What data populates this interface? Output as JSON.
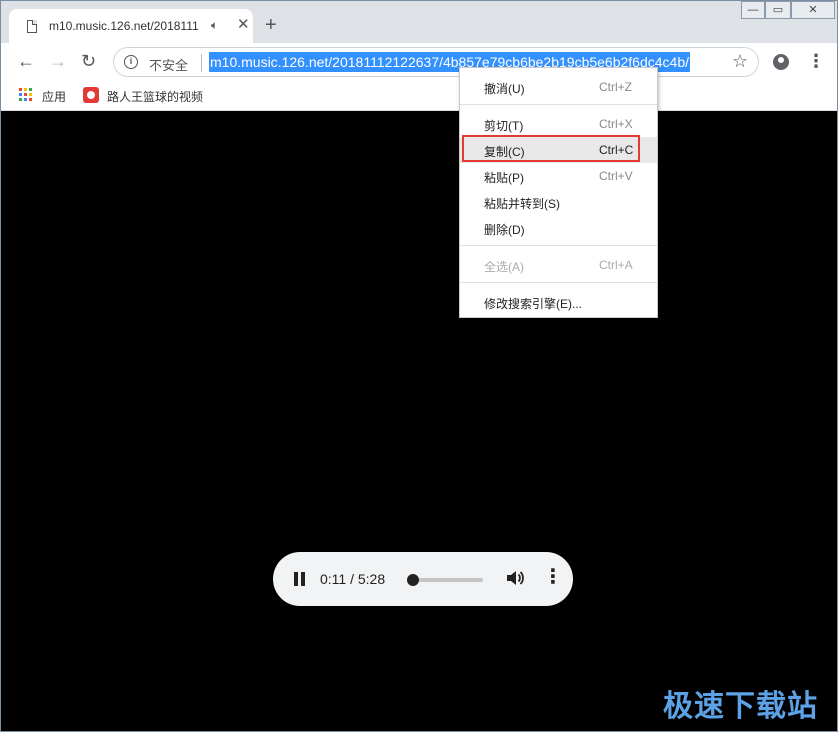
{
  "tab": {
    "title": "m10.music.126.net/2018111",
    "close_glyph": "✕"
  },
  "toolbar": {
    "security_label": "不安全",
    "url": "m10.music.126.net/20181112122637/4b857e79cb6be2b19cb5e6b2f6dc4c4b/"
  },
  "bookmarks": [
    {
      "label": "应用",
      "icon": "apps-grid-icon"
    },
    {
      "label": "路人王篮球的视频",
      "icon": "video-site-icon"
    }
  ],
  "player": {
    "time": "0:11 / 5:28",
    "progress_fraction": 0.035
  },
  "context_menu": {
    "items": [
      {
        "label": "撤消(U)",
        "shortcut": "Ctrl+Z",
        "disabled": false
      },
      {
        "label": "剪切(T)",
        "shortcut": "Ctrl+X",
        "disabled": false
      },
      {
        "label": "复制(C)",
        "shortcut": "Ctrl+C",
        "disabled": false,
        "highlighted": true
      },
      {
        "label": "粘贴(P)",
        "shortcut": "Ctrl+V",
        "disabled": false
      },
      {
        "label": "粘贴并转到(S)",
        "shortcut": "",
        "disabled": false
      },
      {
        "label": "删除(D)",
        "shortcut": "",
        "disabled": false
      },
      {
        "label": "全选(A)",
        "shortcut": "Ctrl+A",
        "disabled": true
      },
      {
        "label": "修改搜索引擎(E)...",
        "shortcut": "",
        "disabled": false
      }
    ]
  },
  "watermark": "极速下载站",
  "colors": {
    "highlight_border": "#e53935",
    "url_selection": "#3390ff",
    "watermark": "#5ba3e6"
  }
}
